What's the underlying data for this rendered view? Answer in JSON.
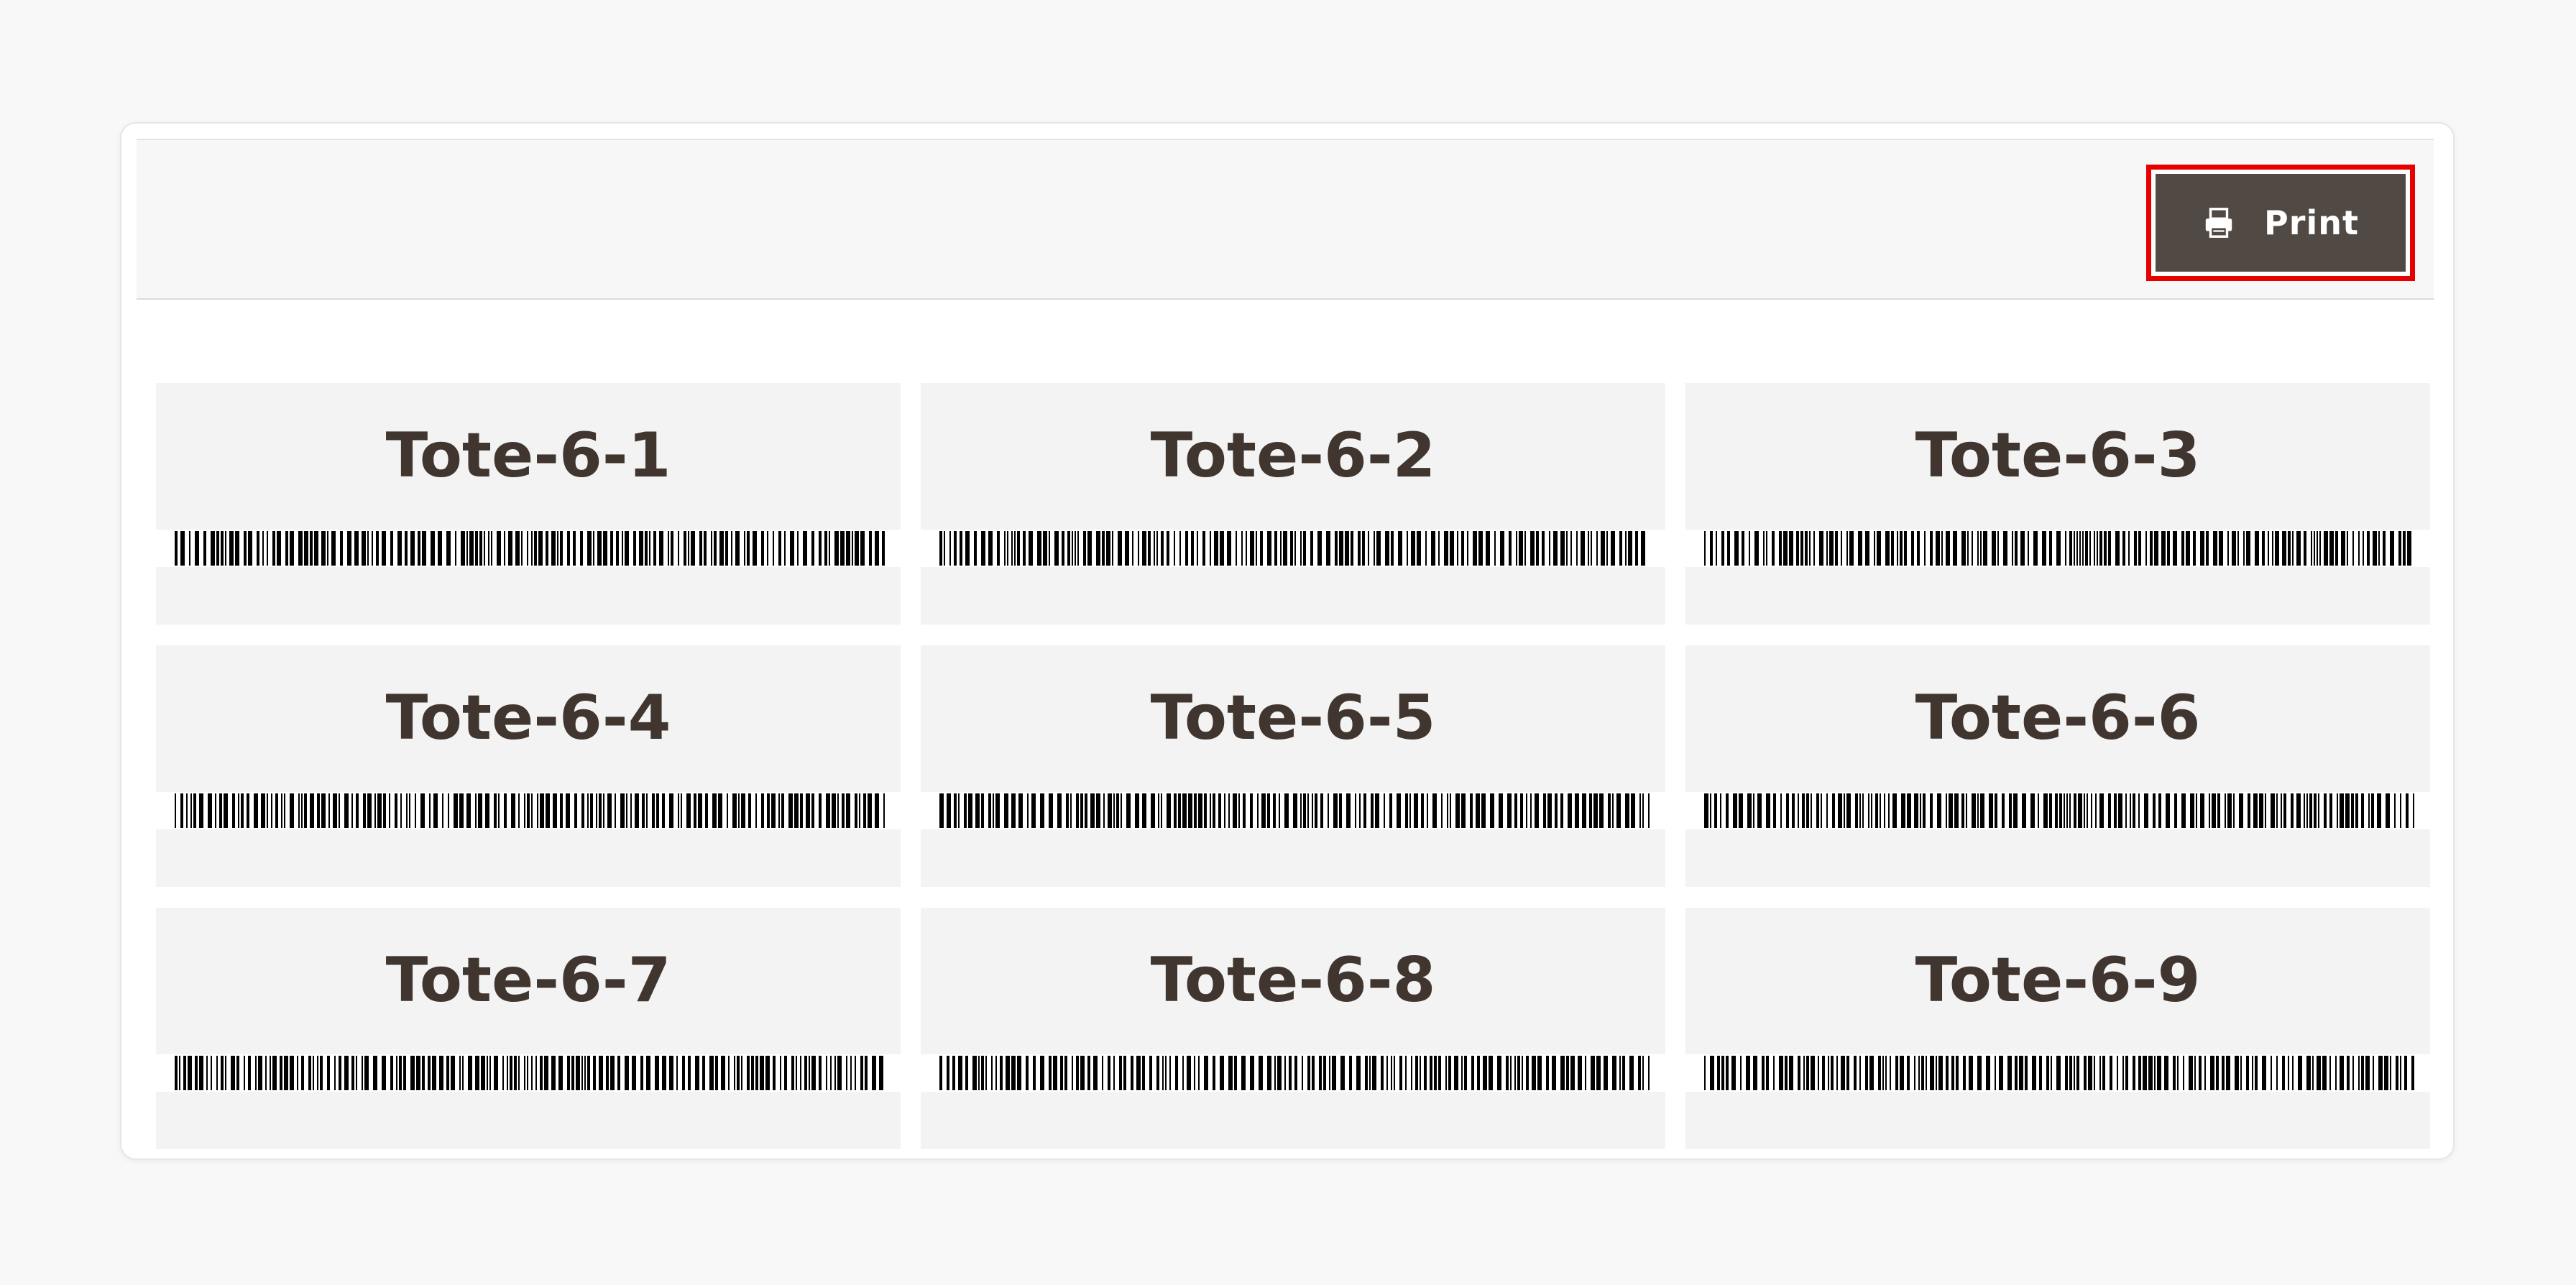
{
  "toolbar": {
    "print_label": "Print",
    "print_icon": "printer-icon"
  },
  "labels": [
    {
      "title": "Tote-6-1"
    },
    {
      "title": "Tote-6-2"
    },
    {
      "title": "Tote-6-3"
    },
    {
      "title": "Tote-6-4"
    },
    {
      "title": "Tote-6-5"
    },
    {
      "title": "Tote-6-6"
    },
    {
      "title": "Tote-6-7"
    },
    {
      "title": "Tote-6-8"
    },
    {
      "title": "Tote-6-9"
    }
  ],
  "colors": {
    "page_background": "#f8f8f8",
    "button_background": "#514943",
    "button_text": "#ffffff",
    "highlight_outline": "#e60000",
    "label_background": "#f3f3f3",
    "label_text": "#41362f"
  }
}
